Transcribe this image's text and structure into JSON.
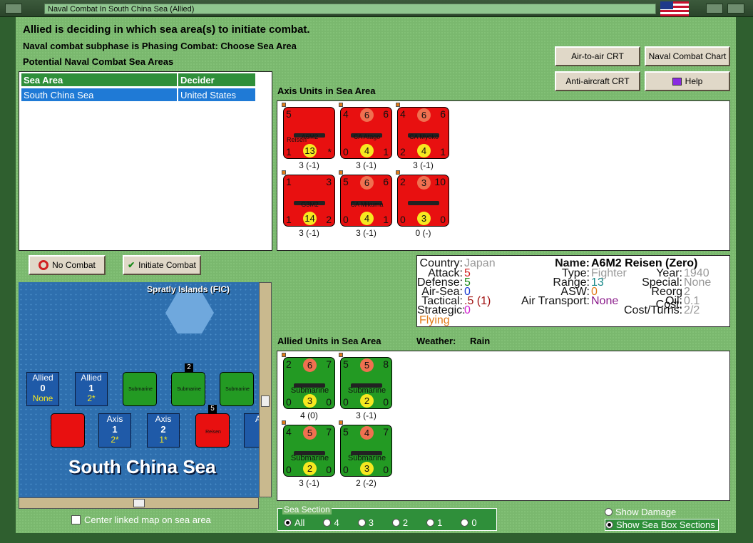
{
  "window": {
    "title": "Naval Combat In South China Sea (Allied)"
  },
  "header": {
    "line1": "Allied is deciding in which sea area(s) to initiate combat.",
    "line2": "Naval combat subphase is Phasing Combat: Choose Sea Area",
    "line3": "Potential Naval Combat Sea Areas"
  },
  "buttons": {
    "air_to_air": "Air-to-air CRT",
    "naval_chart": "Naval Combat Chart",
    "anti_aircraft": "Anti-aircraft CRT",
    "help": "Help",
    "no_combat": "No Combat",
    "initiate": "Initiate Combat"
  },
  "table": {
    "headers": [
      "Sea Area",
      "Decider"
    ],
    "rows": [
      [
        "South China Sea",
        "United States"
      ]
    ]
  },
  "axis_title": "Axis Units in Sea Area",
  "axis_units": [
    {
      "a": "5",
      "b": "",
      "c": "",
      "name": "A6M2",
      "sub": "Reisen",
      "bl": "1",
      "bc": "13",
      "br": "*",
      "stat": "3 (-1)"
    },
    {
      "a": "4",
      "b": "6",
      "c": "6",
      "name": "CA Atago",
      "sub": "",
      "bl": "0",
      "bc": "4",
      "br": "1",
      "stat": "3 (-1)"
    },
    {
      "a": "4",
      "b": "6",
      "c": "6",
      "name": "CA Myoko",
      "sub": "",
      "bl": "2",
      "bc": "4",
      "br": "1",
      "stat": "3 (-1)"
    },
    {
      "a": "1",
      "b": "",
      "c": "3",
      "name": "G3M2",
      "sub": "",
      "bl": "1",
      "bc": "14",
      "br": "2",
      "stat": "3 (-1)"
    },
    {
      "a": "5",
      "b": "6",
      "c": "6",
      "name": "CA Mikuma",
      "sub": "",
      "bl": "0",
      "bc": "4",
      "br": "1",
      "stat": "3 (-1)"
    },
    {
      "a": "2",
      "b": "3",
      "c": "10",
      "name": "",
      "sub": "",
      "bl": "0",
      "bc": "3",
      "br": "0",
      "stat": "0 (-)"
    }
  ],
  "info": {
    "country_l": "Country:",
    "country_v": "Japan",
    "attack_l": "Attack:",
    "attack_v": "5",
    "defense_l": "Defense:",
    "defense_v": "5",
    "airsea_l": "Air-Sea:",
    "airsea_v": "0",
    "tactical_l": "Tactical:",
    "tactical_v": ".5 (1)",
    "strategic_l": "Strategic:",
    "strategic_v": "0",
    "flying": "Flying",
    "name_l": "Name:",
    "name_v": "A6M2 Reisen (Zero)",
    "type_l": "Type:",
    "type_v": "Fighter",
    "range_l": "Range:",
    "range_v": "13",
    "asw_l": "ASW:",
    "asw_v": "0",
    "airtrans_l": "Air Transport:",
    "airtrans_v": "None",
    "year_l": "Year:",
    "year_v": "1940",
    "special_l": "Special:",
    "special_v": "None",
    "reorg_l": "Reorg Cost:",
    "reorg_v": "2",
    "oil_l": "Oil:",
    "oil_v": "0.1",
    "cost_l": "Cost/Turns:",
    "cost_v": "2/2"
  },
  "allied_title": "Allied Units in Sea Area",
  "weather_label": "Weather:",
  "weather_value": "Rain",
  "allied_units": [
    {
      "a": "2",
      "b": "6",
      "c": "7",
      "name": "Submarine",
      "bl": "0",
      "bc": "3",
      "br": "0",
      "stat": "4 (0)"
    },
    {
      "a": "5",
      "b": "5",
      "c": "8",
      "name": "Submarine",
      "bl": "0",
      "bc": "2",
      "br": "0",
      "stat": "3 (-1)"
    },
    {
      "a": "4",
      "b": "5",
      "c": "7",
      "name": "Submarine",
      "bl": "0",
      "bc": "2",
      "br": "0",
      "stat": "3 (-1)"
    },
    {
      "a": "5",
      "b": "4",
      "c": "7",
      "name": "Submarine",
      "bl": "0",
      "bc": "3",
      "br": "0",
      "stat": "2 (-2)"
    }
  ],
  "map": {
    "region": "Spratly Islands (FIC)",
    "sea": "South China Sea",
    "boxes": [
      {
        "side": "Allied",
        "num": "0",
        "sub": "None"
      },
      {
        "side": "Allied",
        "num": "1",
        "sub": "2*"
      },
      {
        "side": "Axis",
        "num": "1",
        "sub": "2*"
      },
      {
        "side": "Axis",
        "num": "2",
        "sub": "1*"
      },
      {
        "side": "Axis",
        "num": "",
        "sub": ""
      }
    ],
    "stack_top": "2",
    "stack_bot": "5",
    "sub_label": "Submarine",
    "plane_label": "Reisen",
    "center_linked": "Center linked map on sea area"
  },
  "sea_section": {
    "title": "Sea Section",
    "options": [
      "All",
      "4",
      "3",
      "2",
      "1",
      "0"
    ]
  },
  "show_damage": "Show Damage",
  "show_sea_box": "Show Sea Box Sections"
}
